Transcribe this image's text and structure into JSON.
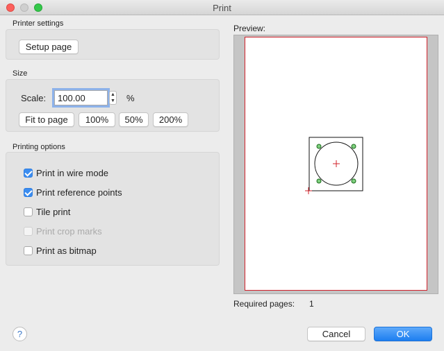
{
  "window": {
    "title": "Print"
  },
  "printer_settings": {
    "label": "Printer settings",
    "setup_button": "Setup page"
  },
  "size": {
    "label": "Size",
    "scale_label": "Scale:",
    "scale_value": "100.00",
    "unit": "%",
    "preset_buttons": {
      "fit": "Fit to page",
      "p100": "100%",
      "p50": "50%",
      "p200": "200%"
    }
  },
  "printing_options": {
    "label": "Printing options",
    "items": [
      {
        "label": "Print in wire mode",
        "checked": true,
        "enabled": true
      },
      {
        "label": "Print reference points",
        "checked": true,
        "enabled": true
      },
      {
        "label": "Tile print",
        "checked": false,
        "enabled": true
      },
      {
        "label": "Print crop marks",
        "checked": false,
        "enabled": false
      },
      {
        "label": "Print as bitmap",
        "checked": false,
        "enabled": true
      }
    ]
  },
  "preview": {
    "label": "Preview:",
    "required_pages_label": "Required pages:",
    "required_pages_value": "1"
  },
  "footer": {
    "help_symbol": "?",
    "cancel": "Cancel",
    "ok": "OK"
  },
  "colors": {
    "accent": "#3b8df0",
    "paper_border": "#d0202a",
    "ref_point": "#1a8a1a"
  }
}
